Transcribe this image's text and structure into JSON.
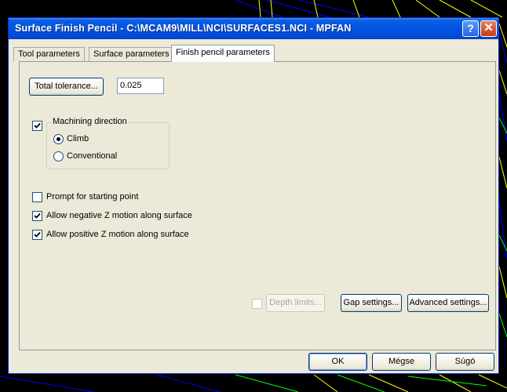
{
  "window": {
    "title": "Surface Finish Pencil - C:\\MCAM9\\MILL\\NCI\\SURFACES1.NCI - MPFAN",
    "help_glyph": "?",
    "close_glyph": "✕"
  },
  "tabs": [
    {
      "label": "Tool parameters",
      "active": false
    },
    {
      "label": "Surface parameters",
      "active": false
    },
    {
      "label": "Finish pencil parameters",
      "active": true
    }
  ],
  "tolerance": {
    "button_label": "Total tolerance...",
    "value": "0.025"
  },
  "machining_direction": {
    "checked": true,
    "title": "Machining direction",
    "options": [
      {
        "label": "Climb",
        "selected": true
      },
      {
        "label": "Conventional",
        "selected": false
      }
    ]
  },
  "options": [
    {
      "label": "Prompt for starting point",
      "checked": false
    },
    {
      "label": "Allow negative Z motion along surface",
      "checked": true
    },
    {
      "label": "Allow positive Z motion along surface",
      "checked": true
    }
  ],
  "bottom_buttons": {
    "depth_limits": {
      "label": "Depth limits...",
      "checked": false,
      "enabled": false
    },
    "gap_settings": "Gap settings...",
    "advanced_settings": "Advanced settings..."
  },
  "footer": {
    "ok": "OK",
    "cancel": "Mégse",
    "help": "Súgó"
  },
  "colors": {
    "titlebar": "#0353e4",
    "dialog_bg": "#ece9d8",
    "desktop_bg": "#000000",
    "cad_lines_yellow": "#ffff00",
    "cad_lines_green": "#00ff00",
    "cad_lines_blue": "#0000ff"
  }
}
